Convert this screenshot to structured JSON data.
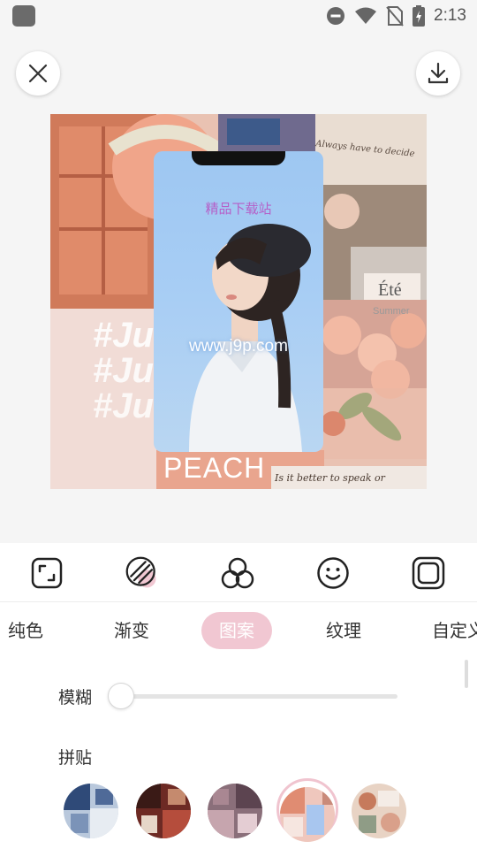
{
  "status_bar": {
    "time": "2:13",
    "icons": [
      "do-not-disturb-icon",
      "wifi-icon",
      "no-sim-icon",
      "battery-charging-icon"
    ]
  },
  "top_bar": {
    "close_icon": "close-icon",
    "download_icon": "download-icon"
  },
  "canvas": {
    "phone_caption": "精品下载站",
    "watermark": "www.j9p.com",
    "collage_texts": {
      "ete": "Été",
      "summer": "Summer",
      "peach": "PEACH",
      "hashtag": "#Ju",
      "handwriting_top": "Always have to decide",
      "handwriting_bottom": "Is it better to speak or"
    }
  },
  "toolbar": {
    "tools": [
      {
        "name": "crop-icon"
      },
      {
        "name": "pattern-icon",
        "selected": true
      },
      {
        "name": "filter-circles-icon"
      },
      {
        "name": "sticker-smile-icon"
      },
      {
        "name": "frame-icon"
      }
    ]
  },
  "tabs": [
    {
      "label": "纯色"
    },
    {
      "label": "渐变"
    },
    {
      "label": "图案",
      "active": true
    },
    {
      "label": "纹理"
    },
    {
      "label": "自定义"
    }
  ],
  "blur": {
    "label": "模糊",
    "value": 0
  },
  "collage": {
    "label": "拼贴",
    "thumbnails": [
      {
        "name": "blue-collage"
      },
      {
        "name": "red-collage"
      },
      {
        "name": "mauve-collage"
      },
      {
        "name": "pink-collage",
        "selected": true
      },
      {
        "name": "beige-collage"
      }
    ]
  },
  "colors": {
    "accent": "#f1c7d2",
    "phone_caption": "#b560c8",
    "panel_bg": "#ffffff",
    "page_bg": "#f5f5f5"
  }
}
